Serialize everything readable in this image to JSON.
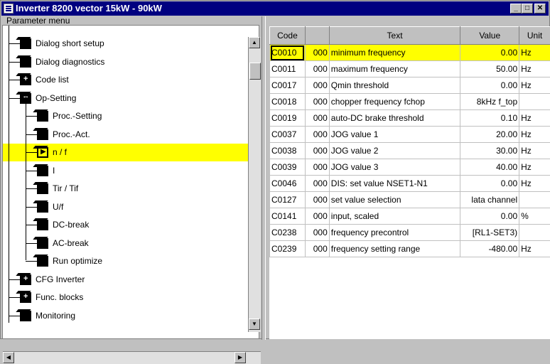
{
  "window": {
    "title": "Inverter 8200 vector 15kW - 90kW",
    "buttons": {
      "minimize": "_",
      "maximize": "□",
      "close": "✕"
    }
  },
  "tree": {
    "header": "Parameter menu",
    "items": [
      {
        "label": "Dialog short setup",
        "icon": "book-icon",
        "level": 0
      },
      {
        "label": "Dialog diagnostics",
        "icon": "book-icon",
        "level": 0
      },
      {
        "label": "Code list",
        "icon": "expand-plus-icon",
        "level": 0
      },
      {
        "label": "Op-Setting",
        "icon": "collapse-minus-icon",
        "level": 0
      },
      {
        "label": "Proc.-Setting",
        "icon": "book-icon",
        "level": 1
      },
      {
        "label": "Proc.-Act.",
        "icon": "book-icon",
        "level": 1
      },
      {
        "label": "n / f",
        "icon": "play-icon",
        "level": 1,
        "selected": true
      },
      {
        "label": "I",
        "icon": "book-icon",
        "level": 1
      },
      {
        "label": "Tir / Tif",
        "icon": "book-icon",
        "level": 1
      },
      {
        "label": "U/f",
        "icon": "book-icon",
        "level": 1
      },
      {
        "label": "DC-break",
        "icon": "book-icon",
        "level": 1
      },
      {
        "label": "AC-break",
        "icon": "book-icon",
        "level": 1
      },
      {
        "label": "Run optimize",
        "icon": "book-icon",
        "level": 1
      },
      {
        "label": "CFG Inverter",
        "icon": "expand-plus-icon",
        "level": 0
      },
      {
        "label": "Func. blocks",
        "icon": "expand-plus-icon",
        "level": 0
      },
      {
        "label": "Monitoring",
        "icon": "book-icon",
        "level": 0
      }
    ]
  },
  "table": {
    "columns": [
      "Code",
      "",
      "Text",
      "Value",
      "Unit"
    ],
    "rows": [
      {
        "code": "C0010",
        "num": "000",
        "text": "minimum frequency",
        "value": "0.00",
        "unit": "Hz",
        "highlight": true
      },
      {
        "code": "C0011",
        "num": "000",
        "text": "maximum frequency",
        "value": "50.00",
        "unit": "Hz"
      },
      {
        "code": "C0017",
        "num": "000",
        "text": "Qmin threshold",
        "value": "0.00",
        "unit": "Hz"
      },
      {
        "code": "C0018",
        "num": "000",
        "text": "chopper frequency fchop",
        "value": "8kHz f_top",
        "unit": ""
      },
      {
        "code": "C0019",
        "num": "000",
        "text": "auto-DC brake threshold",
        "value": "0.10",
        "unit": "Hz"
      },
      {
        "code": "C0037",
        "num": "000",
        "text": "JOG value 1",
        "value": "20.00",
        "unit": "Hz"
      },
      {
        "code": "C0038",
        "num": "000",
        "text": "JOG value 2",
        "value": "30.00",
        "unit": "Hz"
      },
      {
        "code": "C0039",
        "num": "000",
        "text": "JOG value 3",
        "value": "40.00",
        "unit": "Hz"
      },
      {
        "code": "C0046",
        "num": "000",
        "text": "DIS: set value NSET1-N1",
        "value": "0.00",
        "unit": "Hz"
      },
      {
        "code": "C0127",
        "num": "000",
        "text": "set value selection",
        "value": "lata channel",
        "unit": ""
      },
      {
        "code": "C0141",
        "num": "000",
        "text": "input, scaled",
        "value": "0.00",
        "unit": "%"
      },
      {
        "code": "C0238",
        "num": "000",
        "text": "frequency precontrol",
        "value": "[RL1-SET3)",
        "unit": ""
      },
      {
        "code": "C0239",
        "num": "000",
        "text": "frequency setting range",
        "value": "-480.00",
        "unit": "Hz"
      }
    ]
  },
  "colors": {
    "titlebar": "#000080",
    "highlight": "#ffff00",
    "face": "#c0c0c0"
  }
}
